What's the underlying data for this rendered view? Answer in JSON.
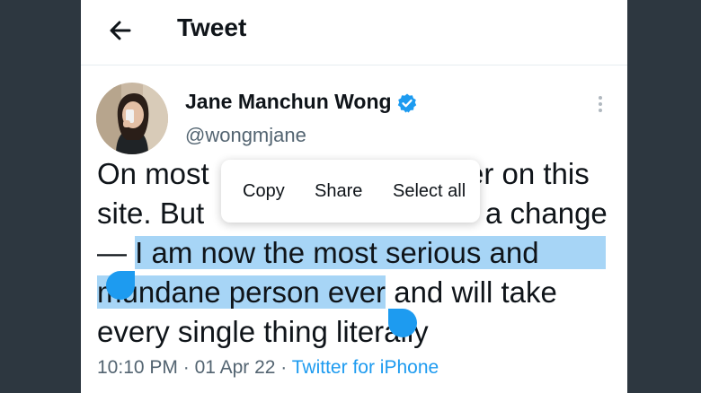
{
  "header": {
    "title": "Tweet",
    "back_icon": "arrow-left-icon"
  },
  "author": {
    "name": "Jane Manchun Wong",
    "handle": "@wongmjane",
    "verified": true,
    "verified_color": "#1d9bf0"
  },
  "tweet": {
    "line1_before": "On most",
    "line1_after": "er on this",
    "line2_before": "site. But",
    "line2_after": "a change",
    "line3_plain": "— ",
    "line3_selected": "I am now the most serious and",
    "line4_selected": "mundane person ever",
    "line4_plain": " and will take",
    "line5": "every single thing literally"
  },
  "selection_menu": {
    "copy": "Copy",
    "share": "Share",
    "select_all": "Select all"
  },
  "meta": {
    "time": "10:10 PM",
    "separator": " · ",
    "date": "01 Apr 22",
    "source": "Twitter for iPhone"
  },
  "colors": {
    "accent": "#1d9bf0",
    "selection": "#a7d5f6",
    "text": "#0f1419",
    "secondary": "#536471",
    "outer_background": "#2d3740"
  }
}
